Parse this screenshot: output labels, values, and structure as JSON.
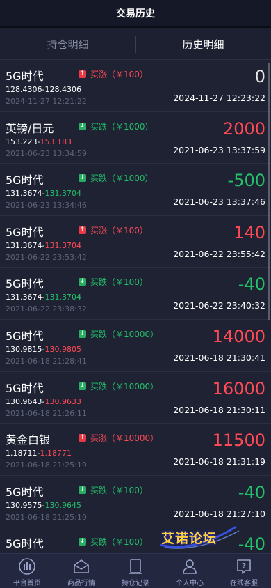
{
  "header": {
    "title": "交易历史"
  },
  "tabs": [
    {
      "label": "持仓明细",
      "active": false
    },
    {
      "label": "历史明细",
      "active": true
    }
  ],
  "records": [
    {
      "name": "5G时代",
      "direction": "rise",
      "dir_label": "买涨（￥100）",
      "open_price": "128.4306",
      "close_price": "128.4306",
      "close_color": "white",
      "open_time": "2024-11-27 12:21:22",
      "amount": "0",
      "amount_color": "white",
      "close_time": "2024-11-27 12:23:22"
    },
    {
      "name": "英镑/日元",
      "direction": "fall",
      "dir_label": "买跌（￥1000）",
      "open_price": "153.223",
      "close_price": "153.183",
      "close_color": "red",
      "open_time": "2021-06-23 13:34:59",
      "amount": "2000",
      "amount_color": "red",
      "close_time": "2021-06-23 13:37:59"
    },
    {
      "name": "5G时代",
      "direction": "fall",
      "dir_label": "买跌（￥1000）",
      "open_price": "131.3674",
      "close_price": "131.3704",
      "close_color": "green",
      "open_time": "2021-06-23 13:34:46",
      "amount": "-500",
      "amount_color": "green",
      "close_time": "2021-06-23 13:37:46"
    },
    {
      "name": "5G时代",
      "direction": "rise",
      "dir_label": "买涨（￥100）",
      "open_price": "131.3674",
      "close_price": "131.3704",
      "close_color": "red",
      "open_time": "2021-06-22 23:53:42",
      "amount": "140",
      "amount_color": "red",
      "close_time": "2021-06-22 23:55:42"
    },
    {
      "name": "5G时代",
      "direction": "fall",
      "dir_label": "买跌（￥100）",
      "open_price": "131.3674",
      "close_price": "131.3704",
      "close_color": "green",
      "open_time": "2021-06-22 23:38:32",
      "amount": "-40",
      "amount_color": "green",
      "close_time": "2021-06-22 23:40:32"
    },
    {
      "name": "5G时代",
      "direction": "fall",
      "dir_label": "买跌（￥10000）",
      "open_price": "130.9815",
      "close_price": "130.9805",
      "close_color": "red",
      "open_time": "2021-06-18 21:28:41",
      "amount": "14000",
      "amount_color": "red",
      "close_time": "2021-06-18 21:30:41"
    },
    {
      "name": "5G时代",
      "direction": "fall",
      "dir_label": "买跌（￥10000）",
      "open_price": "130.9643",
      "close_price": "130.9633",
      "close_color": "red",
      "open_time": "2021-06-18 21:26:11",
      "amount": "16000",
      "amount_color": "red",
      "close_time": "2021-06-18 21:30:11"
    },
    {
      "name": "黄金白银",
      "direction": "rise",
      "dir_label": "买涨（￥10000）",
      "open_price": "1.18711",
      "close_price": "1.18771",
      "close_color": "red",
      "open_time": "2021-06-18 21:25:19",
      "amount": "11500",
      "amount_color": "red",
      "close_time": "2021-06-18 21:31:19"
    },
    {
      "name": "5G时代",
      "direction": "fall",
      "dir_label": "买跌（￥100）",
      "open_price": "130.9575",
      "close_price": "130.9645",
      "close_color": "green",
      "open_time": "2021-06-18 21:25:10",
      "amount": "-40",
      "amount_color": "green",
      "close_time": "2021-06-18 21:27:10"
    },
    {
      "name": "5G时代",
      "direction": "fall",
      "dir_label": "买跌（￥100）",
      "open_price": "",
      "close_price": "",
      "close_color": "green",
      "open_time": "",
      "amount": "-40",
      "amount_color": "green",
      "close_time": ""
    }
  ],
  "watermark": {
    "text": "艾诺论坛"
  },
  "tabbar": [
    {
      "label": "平台首页",
      "icon": "home-logo-icon"
    },
    {
      "label": "商品行情",
      "icon": "market-icon"
    },
    {
      "label": "持仓记录",
      "icon": "position-record-icon"
    },
    {
      "label": "个人中心",
      "icon": "user-icon"
    },
    {
      "label": "在线客服",
      "icon": "help-chat-icon"
    }
  ],
  "colors": {
    "rise": "#ff4a55",
    "fall": "#22c16a",
    "background": "#1c2030",
    "header": "#151826",
    "tabbar": "#232740"
  }
}
